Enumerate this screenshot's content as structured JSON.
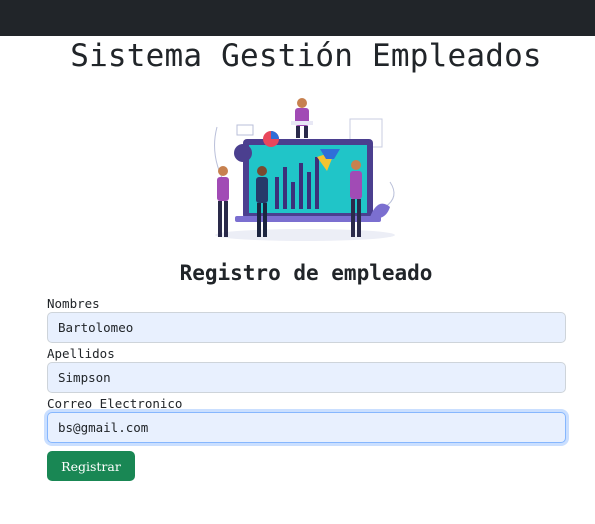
{
  "header": {
    "title": "Sistema Gestión Empleados"
  },
  "illustration": {
    "icon": "team-analytics-illustration"
  },
  "form": {
    "title": "Registro de empleado",
    "nombres": {
      "label": "Nombres",
      "value": "Bartolomeo"
    },
    "apellidos": {
      "label": "Apellidos",
      "value": "Simpson"
    },
    "correo": {
      "label": "Correo Electronico",
      "value": "bs@gmail.com"
    },
    "submit_label": "Registrar"
  },
  "colors": {
    "topbar": "#212529",
    "button": "#198754",
    "input_bg": "#e8f0fe",
    "focus": "#86b7fe"
  }
}
